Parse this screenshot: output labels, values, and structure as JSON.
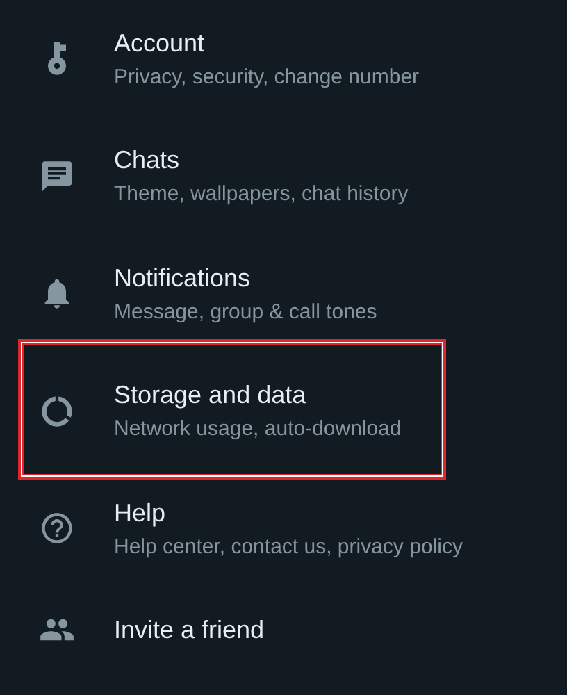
{
  "settings_items": [
    {
      "kind": "key",
      "title": "Account",
      "subtitle": "Privacy, security, change number",
      "highlighted": false
    },
    {
      "kind": "chat",
      "title": "Chats",
      "subtitle": "Theme, wallpapers, chat history",
      "highlighted": false
    },
    {
      "kind": "bell",
      "title": "Notifications",
      "subtitle": "Message, group & call tones",
      "highlighted": false
    },
    {
      "kind": "data",
      "title": "Storage and data",
      "subtitle": "Network usage, auto-download",
      "highlighted": true
    },
    {
      "kind": "help",
      "title": "Help",
      "subtitle": "Help center, contact us, privacy policy",
      "highlighted": false
    },
    {
      "kind": "people",
      "title": "Invite a friend",
      "highlighted": false
    }
  ]
}
